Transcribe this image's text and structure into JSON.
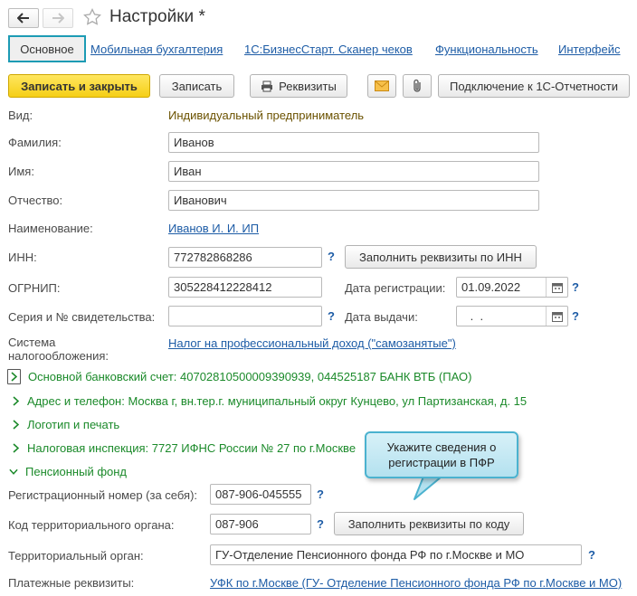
{
  "header": {
    "title": "Настройки *"
  },
  "tabs": [
    {
      "label": "Основное"
    },
    {
      "label": "Мобильная бухгалтерия"
    },
    {
      "label": "1С:БизнесСтарт. Сканер чеков"
    },
    {
      "label": "Функциональность"
    },
    {
      "label": "Интерфейс"
    }
  ],
  "toolbar": {
    "save_close": "Записать и закрыть",
    "save": "Записать",
    "requisites": "Реквизиты",
    "connect": "Подключение к 1С-Отчетности"
  },
  "form": {
    "kind_label": "Вид:",
    "kind_value": "Индивидуальный предприниматель",
    "surname_label": "Фамилия:",
    "surname_value": "Иванов",
    "name_label": "Имя:",
    "name_value": "Иван",
    "patronymic_label": "Отчество:",
    "patronymic_value": "Иванович",
    "title_label": "Наименование:",
    "title_value": "Иванов И. И. ИП",
    "inn_label": "ИНН:",
    "inn_value": "772782868286",
    "inn_fill_button": "Заполнить реквизиты по ИНН",
    "ogrnip_label": "ОГРНИП:",
    "ogrnip_value": "305228412228412",
    "reg_date_label": "Дата регистрации:",
    "reg_date_value": "01.09.2022",
    "cert_label": "Серия и № свидетельства:",
    "cert_value": "",
    "issue_date_label": "Дата выдачи:",
    "issue_date_value": " .  .",
    "tax_system_label": "Система налогообложения:",
    "tax_system_value": "Налог на профессиональный доход (\"самозанятые\")",
    "help_mark": "?"
  },
  "groups": {
    "bank": "Основной банковский счет: 40702810500009390939, 044525187 БАНК ВТБ (ПАО)",
    "address": "Адрес и телефон: Москва г, вн.тер.г. муниципальный округ Кунцево, ул Партизанская, д. 15",
    "logo": "Логотип и печать",
    "tax_office": "Налоговая инспекция: 7727 ИФНС России № 27 по г.Москве",
    "pension": "Пенсионный фонд"
  },
  "pension": {
    "reg_number_label": "Регистрационный номер (за себя):",
    "reg_number_value": "087-906-045555",
    "terr_code_label": "Код территориального органа:",
    "terr_code_value": "087-906",
    "fill_by_code_button": "Заполнить реквизиты по коду",
    "terr_body_label": "Территориальный орган:",
    "terr_body_value": "ГУ-Отделение Пенсионного фонда РФ по г.Москве и МО",
    "payment_label": "Платежные реквизиты:",
    "payment_value": "УФК по г.Москве (ГУ- Отделение Пенсионного фонда РФ по г.Москве и МО)"
  },
  "callout": {
    "line1": "Укажите сведения о",
    "line2": "регистрации в ПФР"
  },
  "colors": {
    "accent_border": "#1c9bb4",
    "link": "#1d5ca6",
    "group_green": "#1b8a2a",
    "primary_button": "#f5cf16"
  }
}
